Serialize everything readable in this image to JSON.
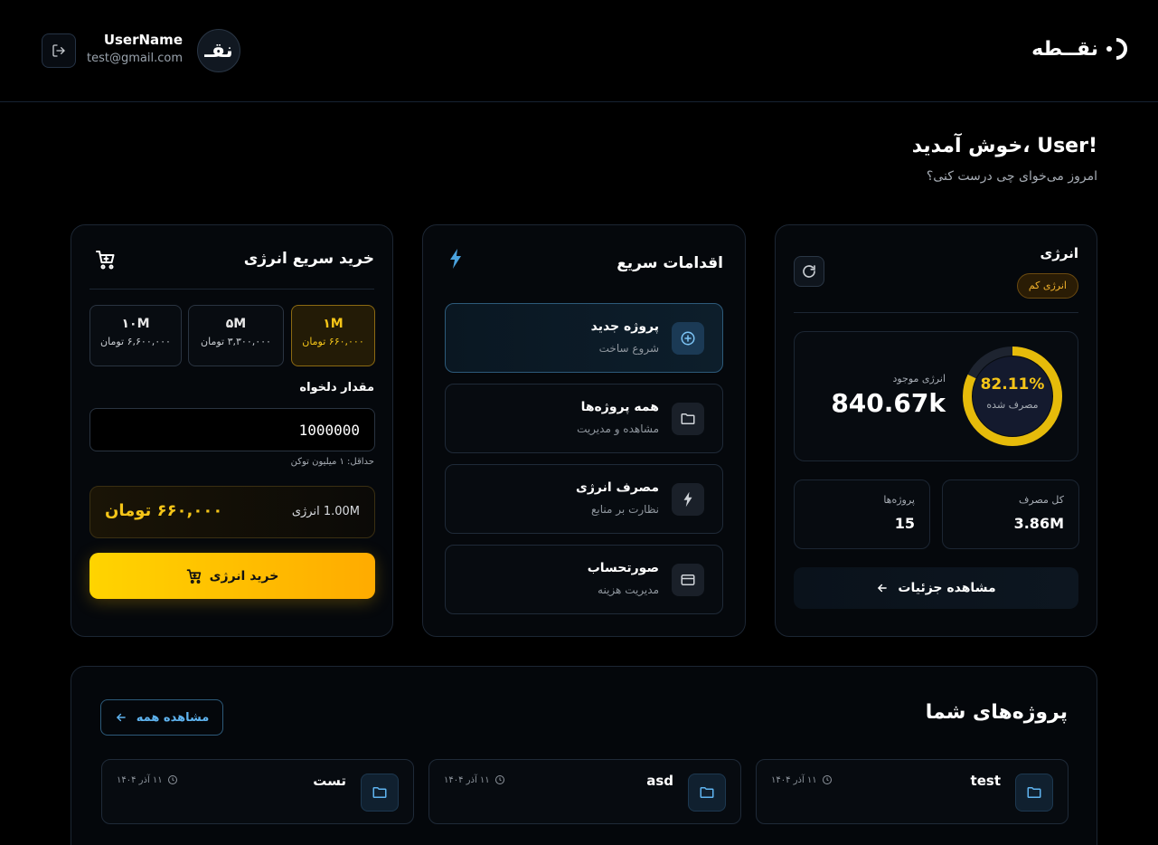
{
  "header": {
    "logo_text": "نقــطه",
    "avatar_text": "نقـ",
    "user_name": "UserName",
    "user_email": "test@gmail.com"
  },
  "welcome": {
    "title": "!User ،خوش آمدید",
    "subtitle": "امروز می‌خوای چی درست کنی؟"
  },
  "energy": {
    "title": "انرژی",
    "badge": "انرژی کم",
    "gauge_percent": "82.11%",
    "gauge_fraction": 0.8211,
    "gauge_label": "مصرف شده",
    "available_label": "انرژی موجود",
    "available_value": "840.67k",
    "total_label": "کل مصرف",
    "total_value": "3.86M",
    "projects_label": "پروژه‌ها",
    "projects_value": "15",
    "details_button": "مشاهده جزئیات"
  },
  "quick_actions": {
    "title": "اقدامات سریع",
    "items": [
      {
        "title": "پروژه جدید",
        "subtitle": "شروع ساخت",
        "icon": "plus-circle-icon"
      },
      {
        "title": "همه پروژه‌ها",
        "subtitle": "مشاهده و مدیریت",
        "icon": "folder-icon"
      },
      {
        "title": "مصرف انرژی",
        "subtitle": "نظارت بر منابع",
        "icon": "bolt-icon"
      },
      {
        "title": "صورتحساب",
        "subtitle": "مدیریت هزینه",
        "icon": "credit-card-icon"
      }
    ]
  },
  "buy": {
    "title": "خرید سریع انرژی",
    "packages": [
      {
        "amount": "۱M",
        "price": "۶۶۰,۰۰۰ تومان",
        "selected": true
      },
      {
        "amount": "۵M",
        "price": "۳,۳۰۰,۰۰۰ تومان",
        "selected": false
      },
      {
        "amount": "۱۰M",
        "price": "۶,۶۰۰,۰۰۰ تومان",
        "selected": false
      }
    ],
    "custom_label": "مقدار دلخواه",
    "custom_value": "1000000",
    "custom_hint": "حداقل: ۱ میلیون توکن",
    "summary_amount": "1.00M انرژی",
    "summary_price": "۶۶۰,۰۰۰ تومان",
    "buy_button": "خرید انرژی"
  },
  "projects": {
    "title": "پروژه‌های شما",
    "view_all": "مشاهده همه",
    "items": [
      {
        "name": "test",
        "date": "۱۱ آذر ۱۴۰۴"
      },
      {
        "name": "asd",
        "date": "۱۱ آذر ۱۴۰۴"
      },
      {
        "name": "تست",
        "date": "۱۱ آذر ۱۴۰۴"
      }
    ]
  },
  "colors": {
    "accent_yellow": "#f5c518",
    "accent_blue": "#5fb4f0",
    "background": "#000000"
  }
}
